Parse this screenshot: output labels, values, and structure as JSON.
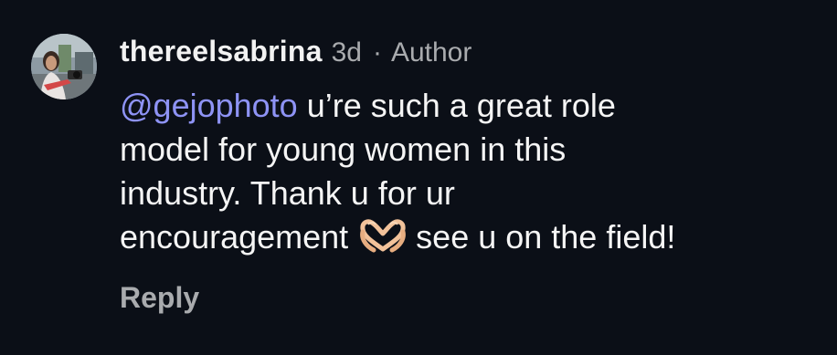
{
  "comment": {
    "username": "thereelsabrina",
    "time": "3d",
    "separator": "·",
    "role": "Author",
    "mention": "@gejophoto",
    "text_line1_after_mention": " u’re such a great role",
    "text_line2": "model for young women in this",
    "text_line3": "industry. Thank u for ur",
    "text_line4_before_emoji": "encouragement",
    "emoji": "heart-hands-emoji",
    "text_line4_after_emoji": "see u on the field!",
    "reply_label": "Reply"
  },
  "colors": {
    "background": "#0b0f17",
    "mention": "#8e93f5",
    "secondary_text": "#a9abae",
    "primary_text": "#f5f5f5"
  }
}
